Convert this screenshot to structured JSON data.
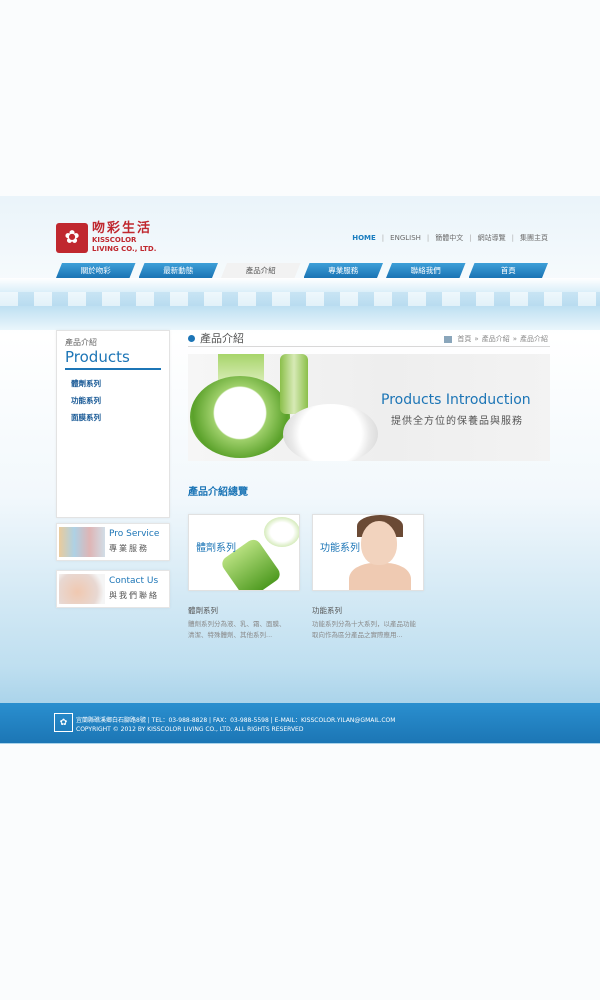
{
  "logo": {
    "mark": "✿",
    "cn": "吻彩生活",
    "en_line1": "KISSCOLOR",
    "en_line2": "LIVING CO., LTD."
  },
  "top_links": [
    "HOME",
    "ENGLISH",
    "簡體中文",
    "網站導覽",
    "集團主頁"
  ],
  "nav": [
    "關於吻彩",
    "最新動態",
    "產品介紹",
    "專業服務",
    "聯絡我們",
    "首頁"
  ],
  "sidebar": {
    "small_label": "產品介紹",
    "title": "Products",
    "items": [
      "體劑系列",
      "功能系列",
      "面膜系列"
    ],
    "cards": [
      {
        "en": "Pro Service",
        "cn": "專業服務"
      },
      {
        "en": "Contact Us",
        "cn": "與我們聯絡"
      }
    ]
  },
  "main": {
    "title": "產品介紹",
    "breadcrumb": [
      "首頁",
      "»",
      "產品介紹",
      "»",
      "產品介紹"
    ],
    "banner_en": "Products Introduction",
    "banner_cn": "提供全方位的保養品與服務",
    "overview_title": "產品介紹總覽",
    "products": [
      {
        "thumb_label": "體劑系列",
        "title": "體劑系列",
        "desc_line1": "體劑系列分為液、乳、霜、面膜、",
        "desc_line2": "清潔、特殊體劑、其他系列..."
      },
      {
        "thumb_label": "功能系列",
        "title": "功能系列",
        "desc_line1": "功能系列分為十大系列，以產品功能",
        "desc_line2": "取向作為區分產品之實際應用..."
      }
    ]
  },
  "footer": {
    "logo": "✿",
    "line1": "宜蘭縣礁溪鄉白石腳路8號 | TEL：03-988-8828 | FAX：03-988-5598 | E-MAIL：KISSCOLOR.YILAN@GMAIL.COM",
    "line2": "COPYRIGHT © 2012 BY KISSCOLOR LIVING CO., LTD. ALL RIGHTS RESERVED"
  },
  "colors": {
    "brand_red": "#c0282f",
    "accent_blue": "#1c75b6",
    "nav_blue": "#2a8fcf"
  }
}
